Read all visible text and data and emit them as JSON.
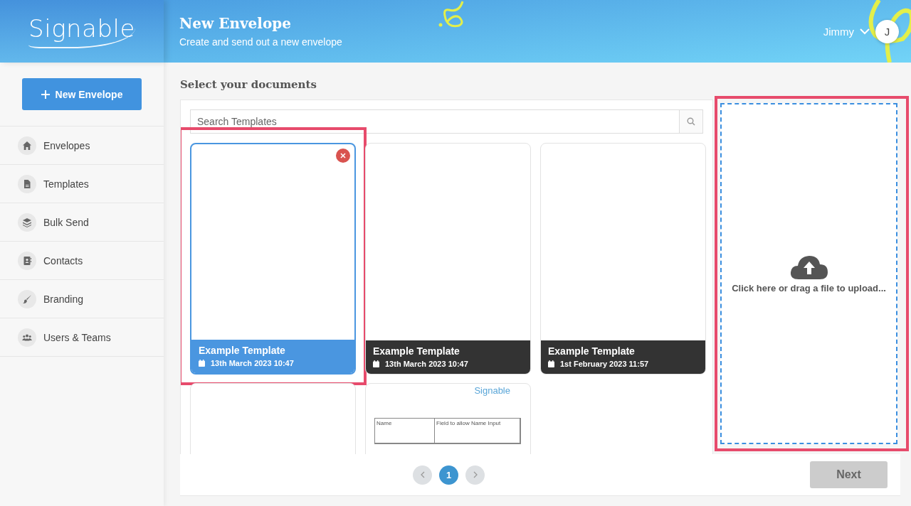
{
  "brand": {
    "logo": "Signable"
  },
  "header": {
    "title": "New Envelope",
    "subtitle": "Create and send out a new envelope",
    "user": {
      "name": "Jimmy",
      "initial": "J"
    }
  },
  "sidebar": {
    "new_button": "New Envelope",
    "items": [
      {
        "label": "Envelopes"
      },
      {
        "label": "Templates"
      },
      {
        "label": "Bulk Send"
      },
      {
        "label": "Contacts"
      },
      {
        "label": "Branding"
      },
      {
        "label": "Users & Teams"
      }
    ]
  },
  "section_title": "Select your documents",
  "search": {
    "placeholder": "Search Templates"
  },
  "templates": [
    {
      "name": "Example Template",
      "date": "13th March 2023 10:47",
      "selected": true,
      "highlighted": true
    },
    {
      "name": "Example Template",
      "date": "13th March 2023 10:47",
      "selected": false,
      "highlighted": false
    },
    {
      "name": "Example Template",
      "date": "1st February 2023 11:57",
      "selected": false,
      "highlighted": false
    },
    {
      "selected": false,
      "highlighted": false
    },
    {
      "selected": false,
      "highlighted": false,
      "preview": {
        "logo": "Signable",
        "cells": [
          "Name",
          "Field to allow Name Input"
        ]
      }
    }
  ],
  "upload": {
    "text": "Click here or drag a file to upload...",
    "highlighted": true
  },
  "pagination": {
    "pages": [
      {
        "label": "1",
        "selected": true
      }
    ]
  },
  "next_button": {
    "label": "Next",
    "disabled": true
  }
}
